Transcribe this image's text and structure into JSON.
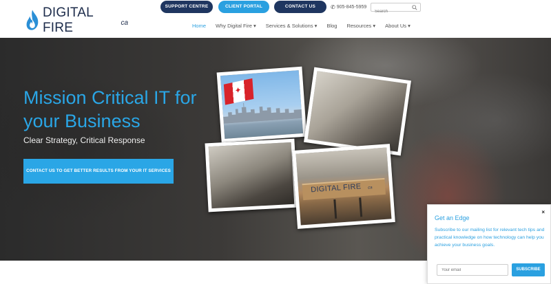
{
  "header": {
    "logo_text": "DIGITAL FIRE",
    "logo_suffix": "ca",
    "top_buttons": {
      "support": "SUPPORT CENTRE",
      "portal": "CLIENT PORTAL",
      "contact": "CONTACT US"
    },
    "phone": "905-845-5959",
    "search_placeholder": "Search",
    "nav": [
      {
        "label": "Home"
      },
      {
        "label": "Why Digital Fire ▾"
      },
      {
        "label": "Services & Solutions ▾"
      },
      {
        "label": "Blog"
      },
      {
        "label": "Resources ▾"
      },
      {
        "label": "About Us ▾"
      }
    ]
  },
  "hero": {
    "title": "Mission Critical IT for your Business",
    "subtitle": "Clear Strategy, Critical Response",
    "cta": "CONTACT US TO GET BETTER RESULTS FROM YOUR IT SERVICES",
    "sign_text": "DIGITAL FIRE",
    "sign_suffix": "ca"
  },
  "popup": {
    "close": "×",
    "title": "Get an Edge",
    "body": "Subscribe to our mailing list for relevant tech tips and practical knowledge on how technology can help you achieve your business goals.",
    "email_placeholder": "Your email",
    "subscribe": "SUBSCRIBE"
  },
  "colors": {
    "accent": "#2aa0e0",
    "navy": "#1f3660"
  }
}
